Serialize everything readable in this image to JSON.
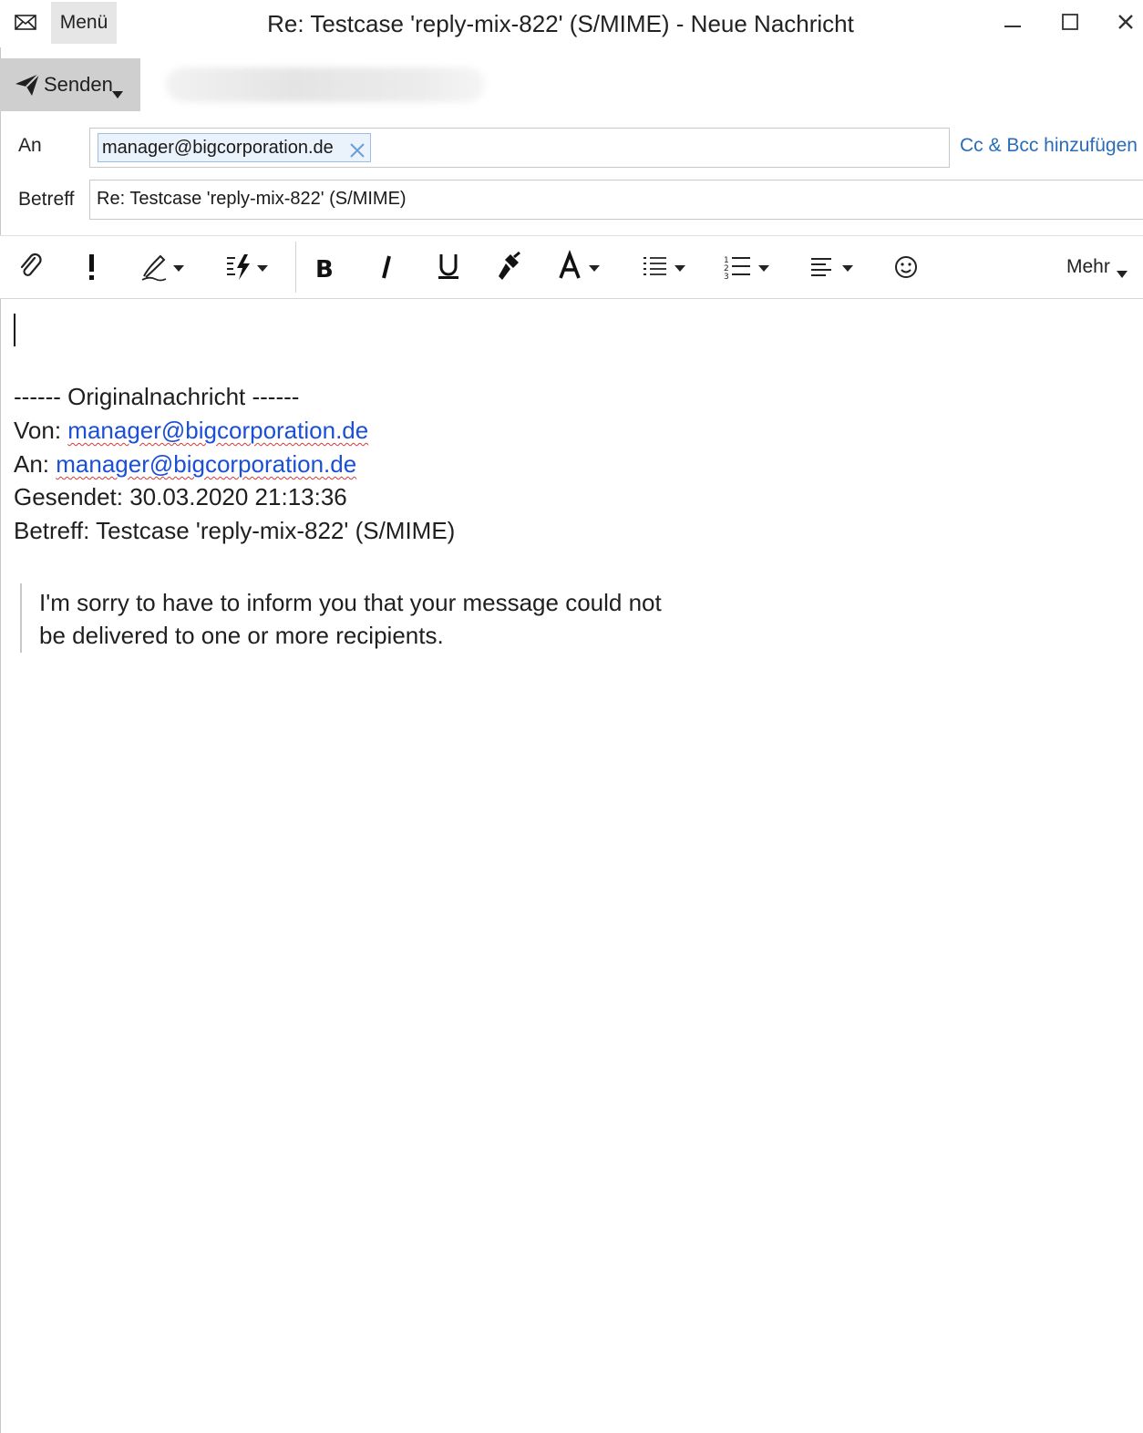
{
  "window": {
    "title": "Re: Testcase 'reply-mix-822' (S/MIME) - Neue Nachricht",
    "menu_label": "Menü"
  },
  "send": {
    "label": "Senden"
  },
  "header": {
    "to_label": "An",
    "to_recipient": "manager@bigcorporation.de",
    "cc_bcc_link": "Cc & Bcc hinzufügen",
    "subject_label": "Betreff",
    "subject_value": "Re: Testcase 'reply-mix-822' (S/MIME)"
  },
  "toolbar": {
    "tools": [
      "paperclip-icon",
      "priority-icon",
      "signature-icon",
      "quick-parts-icon",
      "bold-icon",
      "italic-icon",
      "underline-icon",
      "format-painter-icon",
      "font-icon",
      "bullet-list-icon",
      "numbered-list-icon",
      "align-icon",
      "emoji-icon"
    ],
    "more_label": "Mehr"
  },
  "body": {
    "separator": "------ Originalnachricht ------",
    "from_prefix": "Von: ",
    "from_address": "manager@bigcorporation.de",
    "to_prefix": "An: ",
    "to_address": "manager@bigcorporation.de",
    "sent_line": "Gesendet: 30.03.2020 21:13:36",
    "subject_line": "Betreff: Testcase 'reply-mix-822' (S/MIME)",
    "quote_lines": [
      "I'm sorry to have to inform you that your message could not",
      "be delivered to one or more recipients."
    ]
  },
  "colors": {
    "link": "#1a4fd6",
    "accent_link": "#2b6cb8",
    "send_button_bg": "#cfcfcf",
    "spellcheck": "#d43a3a"
  }
}
